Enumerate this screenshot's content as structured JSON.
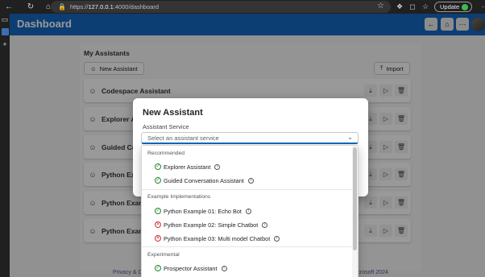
{
  "browser": {
    "url_scheme": "https://",
    "url_host": "127.0.0.1",
    "url_path": ":4000/dashboard",
    "update_label": "Update"
  },
  "app": {
    "title": "Dashboard"
  },
  "panel": {
    "title": "My Assistants",
    "new_label": "New Assistant",
    "import_label": "Import",
    "assistants": [
      "Codespace Assistant",
      "Explorer As",
      "Guided Co",
      "Python Exa",
      "Python Examp",
      "Python Examp"
    ]
  },
  "footer": {
    "left": "Privacy & Co",
    "right": "Microsoft 2024"
  },
  "dialog": {
    "title": "New Assistant",
    "field_label": "Assistant Service",
    "placeholder": "Select an assistant service",
    "groups": [
      {
        "label": "Recommended",
        "options": [
          {
            "label": "Explorer Assistant",
            "status": "ok"
          },
          {
            "label": "Guided Conversation Assistant",
            "status": "ok"
          }
        ]
      },
      {
        "label": "Example Implementations",
        "options": [
          {
            "label": "Python Example 01: Echo Bot",
            "status": "ok"
          },
          {
            "label": "Python Example 02: Simple Chatbot",
            "status": "error"
          },
          {
            "label": "Python Example 03: Multi model Chatbot",
            "status": "error"
          }
        ]
      },
      {
        "label": "Experimental",
        "options": [
          {
            "label": "Prospector Assistant",
            "status": "ok"
          }
        ]
      }
    ]
  },
  "colors": {
    "accent": "#1568c0",
    "ok": "#1f8b2c",
    "error": "#d13438"
  }
}
